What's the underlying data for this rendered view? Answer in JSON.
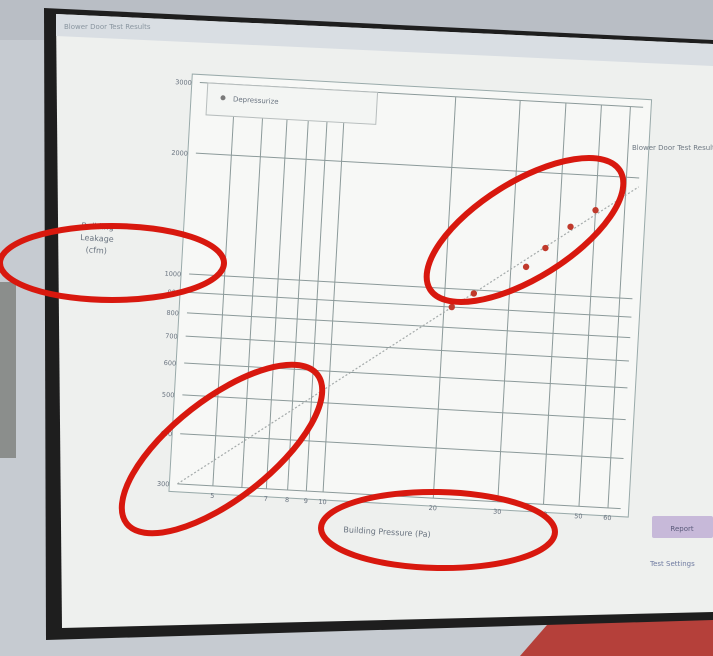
{
  "window": {
    "title": "Blower Door Test Results"
  },
  "chart_data": {
    "type": "scatter",
    "title": "",
    "xlabel": "Building Pressure (Pa)",
    "ylabel_lines": [
      "Building",
      "Leakage",
      "(cfm)"
    ],
    "x_scale": "log",
    "y_scale": "log",
    "xlim": [
      4,
      65
    ],
    "ylim": [
      300,
      3000
    ],
    "x_ticks": [
      {
        "value": 5,
        "label": "5"
      },
      {
        "value": 6,
        "label": "6"
      },
      {
        "value": 7,
        "label": "7"
      },
      {
        "value": 8,
        "label": "8"
      },
      {
        "value": 9,
        "label": "9"
      },
      {
        "value": 10,
        "label": "10"
      },
      {
        "value": 20,
        "label": "20"
      },
      {
        "value": 30,
        "label": "30"
      },
      {
        "value": 40,
        "label": "40"
      },
      {
        "value": 50,
        "label": "50"
      },
      {
        "value": 60,
        "label": "60"
      }
    ],
    "y_ticks": [
      {
        "value": 300,
        "label": "300"
      },
      {
        "value": 400,
        "label": "400"
      },
      {
        "value": 500,
        "label": "500"
      },
      {
        "value": 600,
        "label": "600"
      },
      {
        "value": 700,
        "label": "700"
      },
      {
        "value": 800,
        "label": "800"
      },
      {
        "value": 900,
        "label": "900"
      },
      {
        "value": 1000,
        "label": "1000"
      },
      {
        "value": 2000,
        "label": "2000"
      },
      {
        "value": 3000,
        "label": "3000"
      }
    ],
    "legend": {
      "label": "Depressurize",
      "placement": "top-left"
    },
    "grid": true,
    "series": [
      {
        "name": "Depressurize",
        "color": "#c0392b",
        "x": [
          21,
          24,
          33,
          37,
          43,
          50
        ],
        "y": [
          900,
          980,
          1160,
          1300,
          1480,
          1640
        ]
      }
    ],
    "fit_line": {
      "from": [
        4,
        300
      ],
      "to": [
        65,
        1900
      ]
    }
  },
  "side_panel": {
    "title_text": "Blower Door Test Results",
    "button_label": "Report",
    "note_text": "Test Settings"
  },
  "annotations": {
    "color": "#d8180e",
    "items": [
      "ylabel-ellipse",
      "data-points-ellipse",
      "low-range-ellipse",
      "xlabel-ellipse"
    ]
  }
}
